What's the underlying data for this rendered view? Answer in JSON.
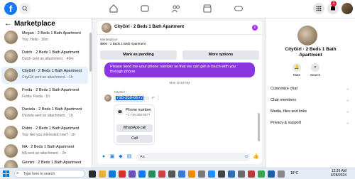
{
  "marketplace": {
    "title": "Marketplace",
    "chats": [
      {
        "title": "Megan · 2 Beds 1 Bath Apartment",
        "subtitle": "You: Hello · 16m"
      },
      {
        "title": "Dutch · 2 Beds 1 Bath Apartment",
        "subtitle": "Dutch sent an attachment. · 40m"
      },
      {
        "title": "CityGirl · 2 Beds 1 Bath Apartment",
        "subtitle": "CityGirl sent an attachment. · 1h"
      },
      {
        "title": "Freda · 2 Beds 1 Bath Apartment",
        "subtitle": "Freda: Freda · 1h"
      },
      {
        "title": "Daviela · 2 Beds 1 Bath Apartment",
        "subtitle": "Daviela sent an attachment. · 1h"
      },
      {
        "title": "Robin · 2 Beds 1 Bath Apartment",
        "subtitle": "You: Are you interested now? · 1h"
      },
      {
        "title": "NA · 2 Beds 1 Bath Apartment",
        "subtitle": "NA sent an attachment. · 2h"
      },
      {
        "title": "Gémini · 2 Beds 1 Bath Apartment",
        "subtitle": ""
      }
    ]
  },
  "conversation": {
    "title": "CityGirl · 2 Beds 1 Bath Apartment",
    "listing_label": "Marketplace",
    "listing_price": "$900 · 2 Beds 1 Bath Apartment",
    "mark_pending": "Mark as pending",
    "more_options": "More options",
    "outgoing_message": "Please send me your phone number so that we can get in touch with you through phone",
    "timestamp": "Mon 10:54 AM",
    "sender": "CityGirl",
    "phone_message": "716-359-6677",
    "phone_card_title": "Phone number",
    "phone_card_number": "+1 716-359-6677",
    "whatsapp_button": "WhatsApp call",
    "call_button": "Call",
    "composer_placeholder": "Aa"
  },
  "info_panel": {
    "title": "CityGirl · 2 Beds 1 Bath Apartment",
    "mute": "Mute",
    "search": "Search",
    "rows": [
      "Customize chat",
      "Chat members",
      "Media, files and links",
      "Privacy & support"
    ]
  },
  "topbar": {
    "notification_count": "1"
  },
  "taskbar": {
    "search_placeholder": "Type here to search",
    "weather": "18°C",
    "time": "12:26 AM",
    "date": "4/28/2024"
  },
  "colors": {
    "accent": "#1877f2",
    "bubble": "#8a36e0"
  }
}
